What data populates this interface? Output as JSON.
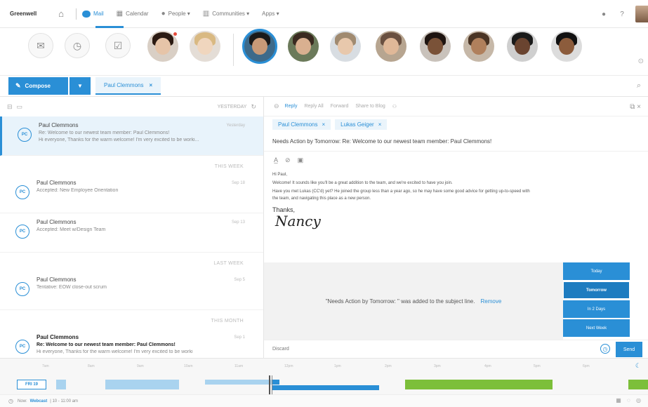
{
  "nav": {
    "brand": "Greenwell",
    "items": [
      {
        "label": "Mail",
        "icon": "mail-icon"
      },
      {
        "label": "Calendar",
        "icon": "calendar-icon"
      },
      {
        "label": "People ▾",
        "icon": "person-icon"
      },
      {
        "label": "Communities ▾",
        "icon": "community-icon"
      },
      {
        "label": "Apps ▾",
        "icon": ""
      }
    ],
    "help": "?",
    "status_dot": "●"
  },
  "strip": {
    "actions": [
      "inbox-icon",
      "clock-icon",
      "checkbox-icon"
    ]
  },
  "compose": {
    "label": "Compose",
    "tab_label": "Paul Clemmons",
    "tab_close": "×"
  },
  "list": {
    "header_right": "YESTERDAY",
    "mails": [
      {
        "from": "Paul Clemmons",
        "initials": "PC",
        "subject": "Re: Welcome to our newest team member: Paul Clemmons!",
        "preview": "Hi everyone, Thanks for the warm welcome! I'm very excited to be worki...",
        "date": "Yesterday"
      },
      {
        "from": "Paul Clemmons",
        "initials": "PC",
        "subject": "Accepted: New Employee Orientation",
        "preview": "",
        "date": "Sep 18"
      },
      {
        "from": "Paul Clemmons",
        "initials": "PC",
        "subject": "Accepted: Meet w/Design Team",
        "preview": "",
        "date": "Sep 13"
      },
      {
        "from": "Paul Clemmons",
        "initials": "PC",
        "subject": "Tentative: EOW close-out scrum",
        "preview": "",
        "date": "Sep 5"
      },
      {
        "from": "Paul Clemmons",
        "initials": "PC",
        "subject": "Re: Welcome to our newest team member: Paul Clemmons!",
        "preview": "Hi everyone, Thanks for the warm welcome! I'm very excited to be worki",
        "date": "Sep 1"
      }
    ],
    "groups": [
      "THIS WEEK",
      "LAST WEEK",
      "THIS MONTH"
    ]
  },
  "pane": {
    "actions": [
      "Reply",
      "Reply All",
      "Forward",
      "Share to Blog"
    ],
    "recipients": [
      "Paul Clemmons",
      "Lukas Geiger"
    ],
    "subject": "Needs Action by Tomorrow: Re: Welcome to our newest team member: Paul Clemmons!",
    "body_lines": [
      "Hi Paul,",
      "Welcome! It sounds like you'll be a great addition to the team, and we're excited to have you join.",
      "Have you met Lukas (CC'd) yet? He joined the group less than a year ago, so he may have some good advice for getting up-to-speed with",
      "the team, and navigating this place as a new person."
    ],
    "thanks": "Thanks,",
    "signature": "Nancy",
    "notice": "\"Needs Action by Tomorrow: \" was added to the subject line.",
    "remove": "Remove",
    "options": [
      "Today",
      "Tomorrow",
      "In 2 Days",
      "Next Week"
    ],
    "selected_option": "Tomorrow",
    "discard": "Discard",
    "send": "Send"
  },
  "timeline": {
    "day_label": "FRI 19",
    "hours": [
      "7am",
      "8am",
      "9am",
      "10am",
      "11am",
      "12pm",
      "1pm",
      "2pm",
      "3pm",
      "4pm",
      "5pm",
      "6pm",
      "7pm"
    ]
  },
  "status": {
    "now_label": "Now:",
    "now_event": "Webcast",
    "now_time": "| 10 - 11:00 am"
  }
}
